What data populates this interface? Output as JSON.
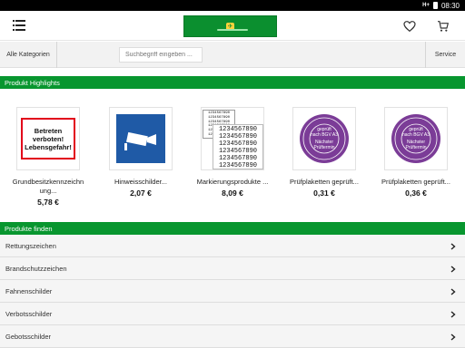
{
  "status_bar": {
    "network": "H+",
    "time": "08:30"
  },
  "header": {
    "logo_mark": "✈"
  },
  "toolbar": {
    "categories_label": "Alle Kategorien",
    "search_placeholder": "Suchbegriff eingeben ...",
    "service_label": "Service"
  },
  "highlights": {
    "title": "Produkt Highlights",
    "products": [
      {
        "name_line1": "Grundbesitzkennzeichn",
        "name_line2": "ung...",
        "price": "5,78 €",
        "image_text": [
          "Betreten",
          "verboten!",
          "Lebensgefahr!"
        ]
      },
      {
        "name_line1": "Hinweisschilder...",
        "name_line2": "",
        "price": "2,07 €"
      },
      {
        "name_line1": "Markierungsprodukte ...",
        "name_line2": "",
        "price": "8,09 €",
        "image_text": "1234567890"
      },
      {
        "name_line1": "Prüfplaketten geprüft...",
        "name_line2": "",
        "price": "0,31 €",
        "image_text": [
          "geprüft",
          "nach BGV A3",
          "Nächster",
          "Prüftermin"
        ]
      },
      {
        "name_line1": "Prüfplaketten geprüft...",
        "name_line2": "",
        "price": "0,36 €",
        "image_text": [
          "geprüft",
          "nach BGV A3",
          "Nächster",
          "Prüftermin"
        ]
      }
    ]
  },
  "find": {
    "title": "Produkte finden",
    "items": [
      "Rettungszeichen",
      "Brandschutzzeichen",
      "Fahnenschilder",
      "Verbotsschilder",
      "Gebotsschilder"
    ]
  },
  "colors": {
    "accent": "#08962f",
    "plakette": "#7b3c97",
    "camera_sign": "#1f5aa6",
    "warning_border": "#e2001a"
  },
  "icons": [
    "menu-icon",
    "heart-icon",
    "cart-icon",
    "chevron-right-icon"
  ]
}
